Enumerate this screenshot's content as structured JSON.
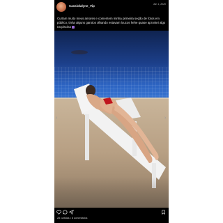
{
  "post": {
    "username": "Cassiolalyne_Vip",
    "date": "Jun 1, 2020",
    "caption": "Curtam muito meus amores e comentem minha primeira seção de fotos em público, tinha alguns garotos olhando estavam loucos hehe quase aprontei algo na piscina",
    "stats": "28 curtidas • 8 comentários"
  },
  "icons": {
    "avatar": "profile-avatar",
    "prev": "chevron-left-icon",
    "next": "chevron-right-icon",
    "like": "heart-icon",
    "comment": "comment-icon",
    "share": "share-icon",
    "save": "bookmark-icon"
  },
  "colors": {
    "background": "#000000",
    "page": "#ffffff",
    "bikini": "#c0141c",
    "pool": "#2d64c2"
  },
  "carousel": {
    "slide_count": 2
  }
}
